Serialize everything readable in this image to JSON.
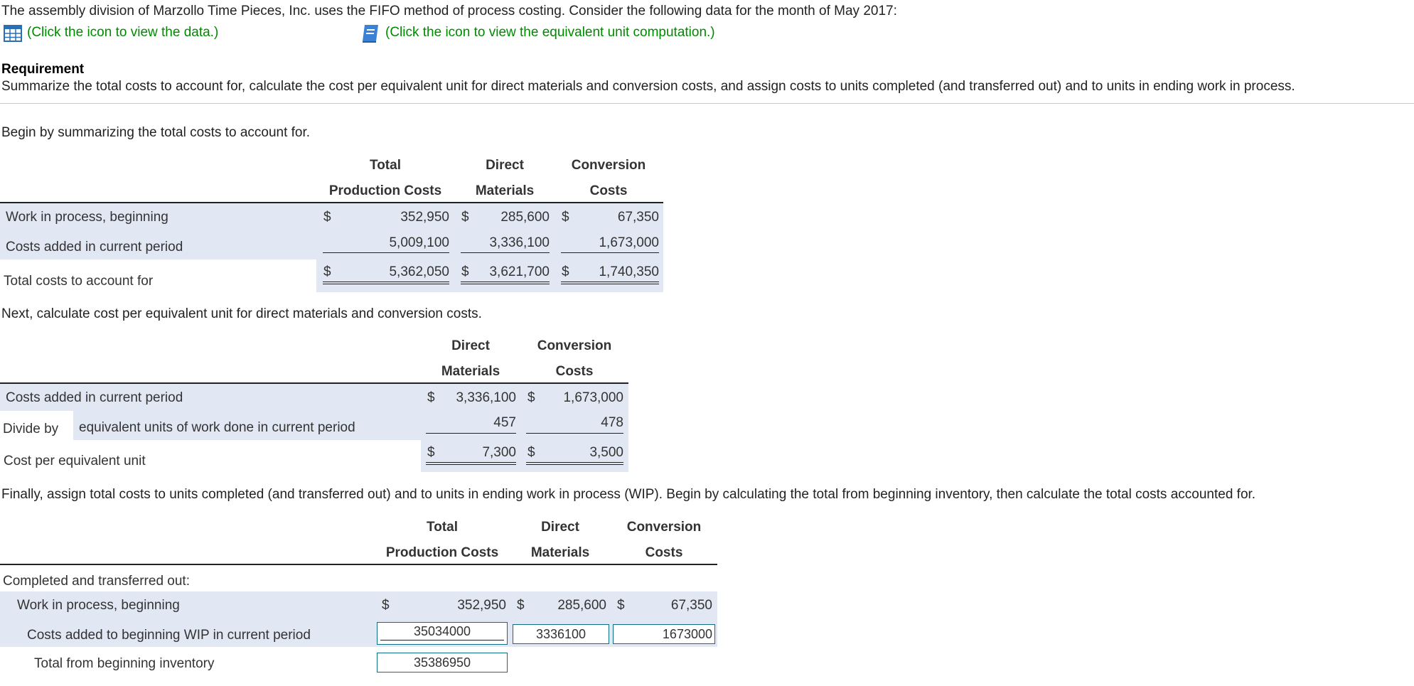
{
  "intro": "The assembly division of Marzollo Time Pieces, Inc. uses the FIFO method of process costing. Consider the following data for the month of May 2017:",
  "links": {
    "data": "(Click the icon to view the data.)",
    "equiv": "(Click the icon to view the equivalent unit computation.)"
  },
  "requirement": {
    "heading": "Requirement",
    "text": "Summarize the total costs to account for, calculate the cost per equivalent unit for direct materials and conversion costs, and assign costs to units completed (and transferred out) and to units in ending work in process."
  },
  "section1": {
    "intro": "Begin by summarizing the total costs to account for.",
    "headers": {
      "total_1": "Total",
      "total_2": "Production Costs",
      "dm_1": "Direct",
      "dm_2": "Materials",
      "cc_1": "Conversion",
      "cc_2": "Costs"
    },
    "rows": [
      {
        "label": "Work in process, beginning",
        "total": "352,950",
        "dm": "285,600",
        "cc": "67,350"
      },
      {
        "label": "Costs added in current period",
        "total": "5,009,100",
        "dm": "3,336,100",
        "cc": "1,673,000"
      },
      {
        "label": "Total costs to account for",
        "total": "5,362,050",
        "dm": "3,621,700",
        "cc": "1,740,350"
      }
    ],
    "currency": "$"
  },
  "section2": {
    "intro": "Next, calculate cost per equivalent unit for direct materials and conversion costs.",
    "headers": {
      "dm_1": "Direct",
      "dm_2": "Materials",
      "cc_1": "Conversion",
      "cc_2": "Costs"
    },
    "row1": {
      "label": "Costs added in current period",
      "dm": "3,336,100",
      "cc": "1,673,000"
    },
    "row2": {
      "label_a": "Divide by",
      "label_b": "equivalent units of work done in current period",
      "dm": "457",
      "cc": "478"
    },
    "row3": {
      "label": "Cost per equivalent unit",
      "dm": "7,300",
      "cc": "3,500"
    },
    "currency": "$"
  },
  "section3": {
    "intro": "Finally, assign total costs to units completed (and transferred out) and to units in ending work in process (WIP). Begin by calculating the total from beginning inventory, then calculate the total costs accounted for.",
    "headers": {
      "total_1": "Total",
      "total_2": "Production Costs",
      "dm_1": "Direct",
      "dm_2": "Materials",
      "cc_1": "Conversion",
      "cc_2": "Costs"
    },
    "group_label": "Completed and transferred out:",
    "row1": {
      "label": "Work in process, beginning",
      "total": "352,950",
      "dm": "285,600",
      "cc": "67,350"
    },
    "row2": {
      "label": "Costs added to beginning WIP in current period",
      "total": "35034000",
      "dm": "3336100",
      "cc": "1673000"
    },
    "row3": {
      "label": "Total from beginning inventory",
      "total": "35386950"
    },
    "currency": "$"
  }
}
